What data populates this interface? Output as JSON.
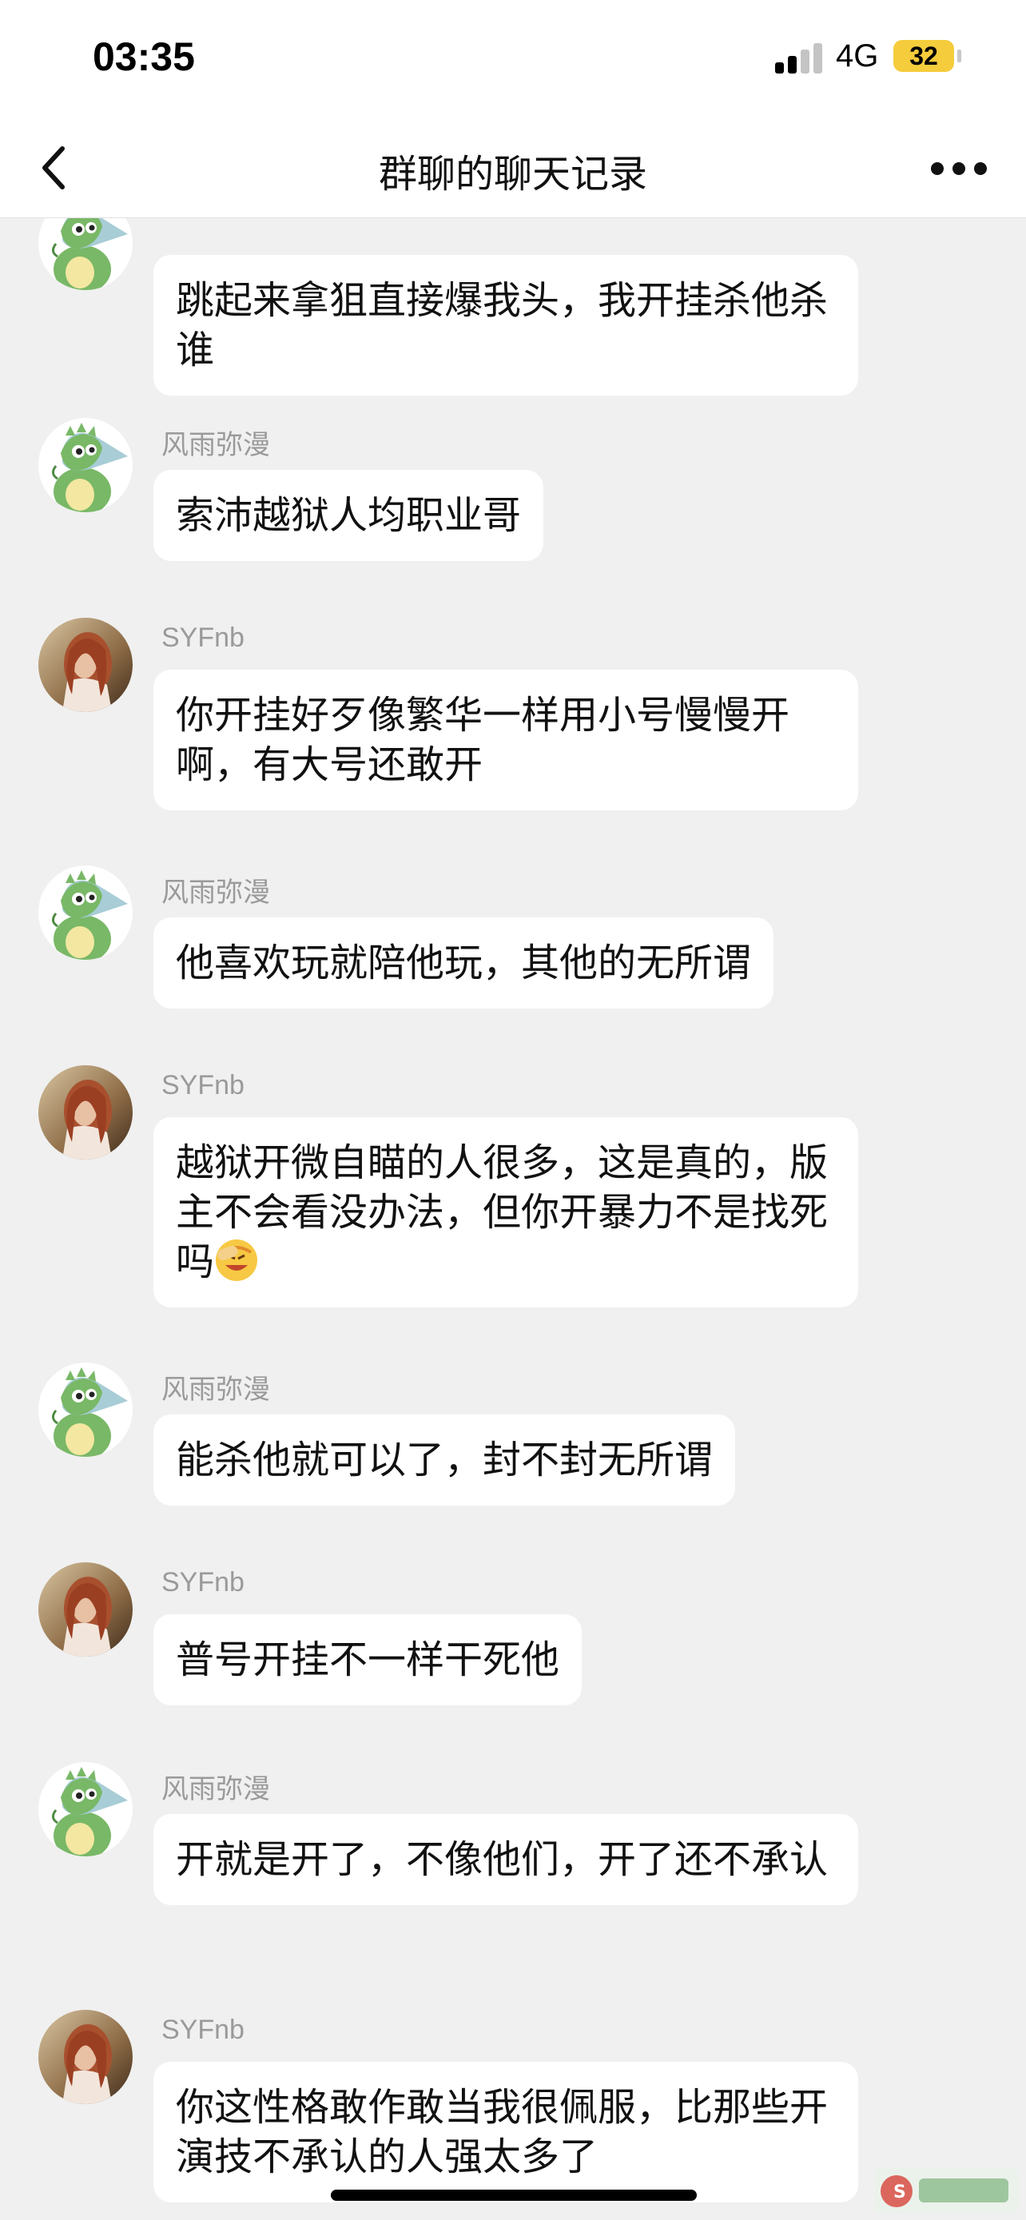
{
  "status_bar": {
    "time": "03:35",
    "network": "4G",
    "battery": "32"
  },
  "nav": {
    "title": "群聊的聊天记录",
    "back_icon": "chevron-left-icon",
    "more_icon": "more-dots-icon"
  },
  "messages": [
    {
      "sender": "",
      "text": "跳起来拿狙直接爆我头，我开挂杀他杀谁",
      "avatar": "dinosaur-avatar"
    },
    {
      "sender": "风雨弥漫",
      "text": "索沛越狱人均职业哥",
      "avatar": "dinosaur-avatar"
    },
    {
      "sender": "SYFnb",
      "text": "你开挂好歹像繁华一样用小号慢慢开啊，有大号还敢开",
      "avatar": "photo-avatar"
    },
    {
      "sender": "风雨弥漫",
      "text": "他喜欢玩就陪他玩，其他的无所谓",
      "avatar": "dinosaur-avatar"
    },
    {
      "sender": "SYFnb",
      "text": "越狱开微自瞄的人很多，这是真的，版主不会看没办法，但你开暴力不是找死吗",
      "avatar": "photo-avatar",
      "emoji": "facepalm-emoji"
    },
    {
      "sender": "风雨弥漫",
      "text": "能杀他就可以了，封不封无所谓",
      "avatar": "dinosaur-avatar"
    },
    {
      "sender": "SYFnb",
      "text": "普号开挂不一样干死他",
      "avatar": "photo-avatar"
    },
    {
      "sender": "风雨弥漫",
      "text": "开就是开了，不像他们，开了还不承认",
      "avatar": "dinosaur-avatar"
    },
    {
      "sender": "SYFnb",
      "text": "你这性格敢作敢当我很佩服，比那些开演技不承认的人强太多了",
      "avatar": "photo-avatar"
    }
  ],
  "colors": {
    "background": "#f0f0f0",
    "bubble": "#ffffff",
    "battery": "#f5cc3c",
    "sender_text": "#9a9a9a"
  }
}
